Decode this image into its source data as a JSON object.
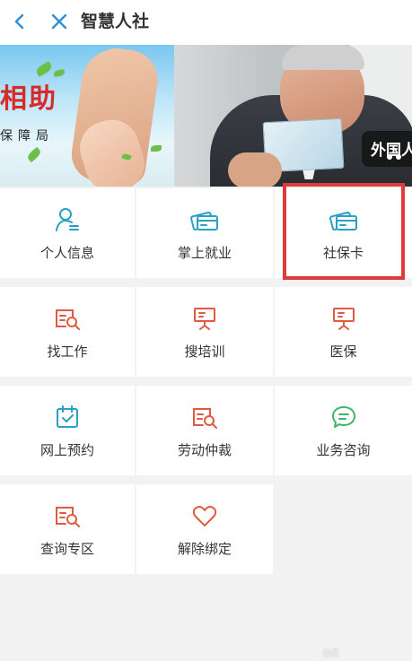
{
  "header": {
    "title": "智慧人社",
    "back_icon": "chevron-left-icon",
    "close_icon": "close-icon",
    "icon_color": "#2f8fd8"
  },
  "banner": {
    "left_slide": {
      "headline": "相助",
      "subline": "保障局"
    },
    "right_slide": {
      "tag_text": "外国人"
    }
  },
  "grid": {
    "accent_blue": "#2aa0c7",
    "accent_red": "#e05a3f",
    "accent_green": "#42b36b",
    "highlight_color": "#e03a3a",
    "items": [
      {
        "label": "个人信息",
        "icon": "person-icon"
      },
      {
        "label": "掌上就业",
        "icon": "cards-icon"
      },
      {
        "label": "社保卡",
        "icon": "cards-icon",
        "highlighted": true
      },
      {
        "label": "找工作",
        "icon": "search-document-icon"
      },
      {
        "label": "搜培训",
        "icon": "presentation-icon"
      },
      {
        "label": "医保",
        "icon": "presentation-icon"
      },
      {
        "label": "网上预约",
        "icon": "calendar-check-icon"
      },
      {
        "label": "劳动仲裁",
        "icon": "search-document-icon"
      },
      {
        "label": "业务咨询",
        "icon": "chat-icon"
      },
      {
        "label": "查询专区",
        "icon": "search-document-icon"
      },
      {
        "label": "解除绑定",
        "icon": "heart-icon"
      }
    ]
  }
}
